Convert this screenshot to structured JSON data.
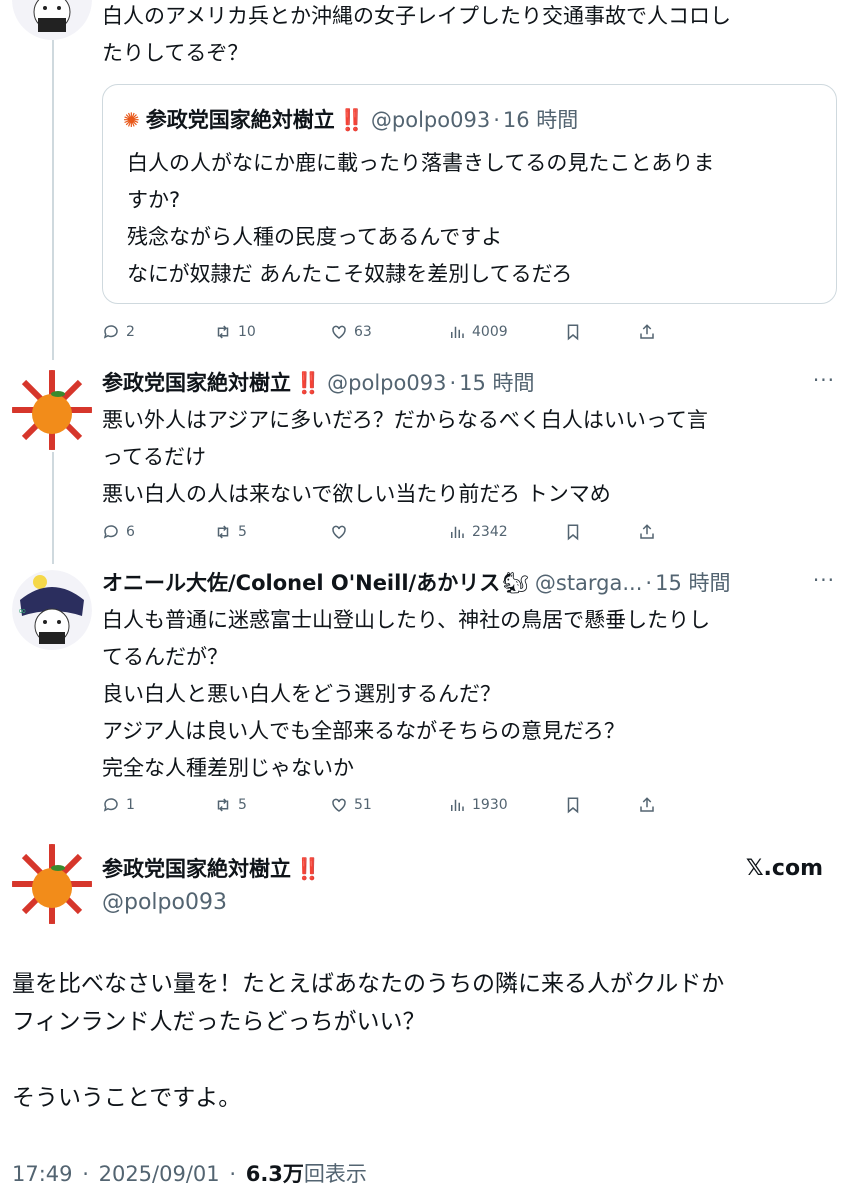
{
  "tweet1": {
    "lines": [
      "白人のアメリカ兵とか沖縄の女子レイプしたり交通事故で人コロし",
      "たりしてるぞ？"
    ],
    "quote": {
      "name": "参政党国家絶対樹立",
      "bang": "‼️",
      "handle": "@polpo093",
      "time": "16 時間",
      "lines": [
        "白人の人がなにか鹿に載ったり落書きしてるの見たことありま",
        "すか?",
        "残念ながら人種の民度ってあるんですよ",
        "なにが奴隷だ あんたこそ奴隷を差別してるだろ"
      ]
    },
    "replies": "2",
    "retweets": "10",
    "likes": "63",
    "views": "4009"
  },
  "tweet2": {
    "name": "参政党国家絶対樹立",
    "bang": "‼️",
    "handle": "@polpo093",
    "time": "15 時間",
    "lines": [
      "悪い外人はアジアに多いだろ？だからなるべく白人はいいって言",
      "ってるだけ",
      "悪い白人の人は来ないで欲しい当たり前だろ トンマめ"
    ],
    "replies": "6",
    "retweets": "5",
    "likes": "",
    "views": "2342"
  },
  "tweet3": {
    "name": "オニール大佐/Colonel O'Neill/あかリス",
    "emoji": "🐿",
    "handle": "@starga...",
    "time": "15 時間",
    "lines": [
      "白人も普通に迷惑富士山登山したり、神社の鳥居で懸垂したりし",
      "てるんだが？",
      "良い白人と悪い白人をどう選別するんだ？",
      "アジア人は良い人でも全部来るながそちらの意見だろ？",
      "完全な人種差別じゃないか"
    ],
    "replies": "1",
    "retweets": "5",
    "likes": "51",
    "views": "1930"
  },
  "main": {
    "name": "参政党国家絶対樹立",
    "bang": "‼️",
    "handle": "@polpo093",
    "source": "𝕏.com",
    "lines": [
      "量を比べなさい量を！たとえばあなたのうちの隣に来る人がクルドか",
      "フィンランド人だったらどっちがいい？",
      "",
      "そういうことですよ。"
    ],
    "time": "17:49",
    "date": "2025/09/01",
    "views_count": "6.3",
    "views_unit": "万",
    "views_label": "回表示"
  },
  "separator": "·",
  "more": "···"
}
